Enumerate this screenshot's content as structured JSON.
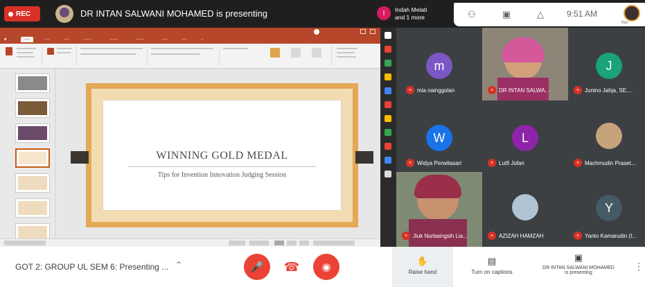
{
  "topbar": {
    "rec_label": "REC",
    "presenting_text": "DR INTAN SALWANI MOHAMED is presenting",
    "participants_pill": {
      "initial": "I",
      "line1": "Indah Melati",
      "line2": "and 1 more"
    },
    "time": "9:51 AM",
    "user_label": "You",
    "icons": [
      "people-icon",
      "chat-icon",
      "activities-icon"
    ]
  },
  "slide": {
    "title": "WINNING GOLD MEDAL",
    "subtitle": "Tips for Invention Innovation Judging Session"
  },
  "participants": [
    {
      "name": "mia nainggolan",
      "initial": "m",
      "color": "#7b57c5"
    },
    {
      "name": "DR INTAN SALWA...",
      "initial": "",
      "color": ""
    },
    {
      "name": "Junino Jahja, SE,...",
      "initial": "J",
      "color": "#1aa37a"
    },
    {
      "name": "Widya Perwitasari",
      "initial": "W",
      "color": "#1a73e8"
    },
    {
      "name": "Lutfi Jufan",
      "initial": "L",
      "color": "#8e24aa"
    },
    {
      "name": "Machmudin Praset...",
      "initial": "",
      "color": ""
    },
    {
      "name": "Jiuk Nurbaingsih Lia...",
      "initial": "",
      "color": ""
    },
    {
      "name": "AZIZAH HAMZAH",
      "initial": "",
      "color": ""
    },
    {
      "name": "Yanto Kamarudin (I...",
      "initial": "Y",
      "color": "#455a64"
    }
  ],
  "bottombar": {
    "meeting_title": "GOT 2: GROUP UL SEM 6: Presenting ...",
    "raise_hand": "Raise hand",
    "captions": "Turn on captions",
    "presenting_line1": "DR INTAN SALWANI MOHAMED",
    "presenting_line2": "is presenting"
  },
  "colors": {
    "accent_red": "#ea4335",
    "dark_bg": "#202124",
    "tile_bg": "#3c4043",
    "ppt_brand": "#b7472a"
  }
}
